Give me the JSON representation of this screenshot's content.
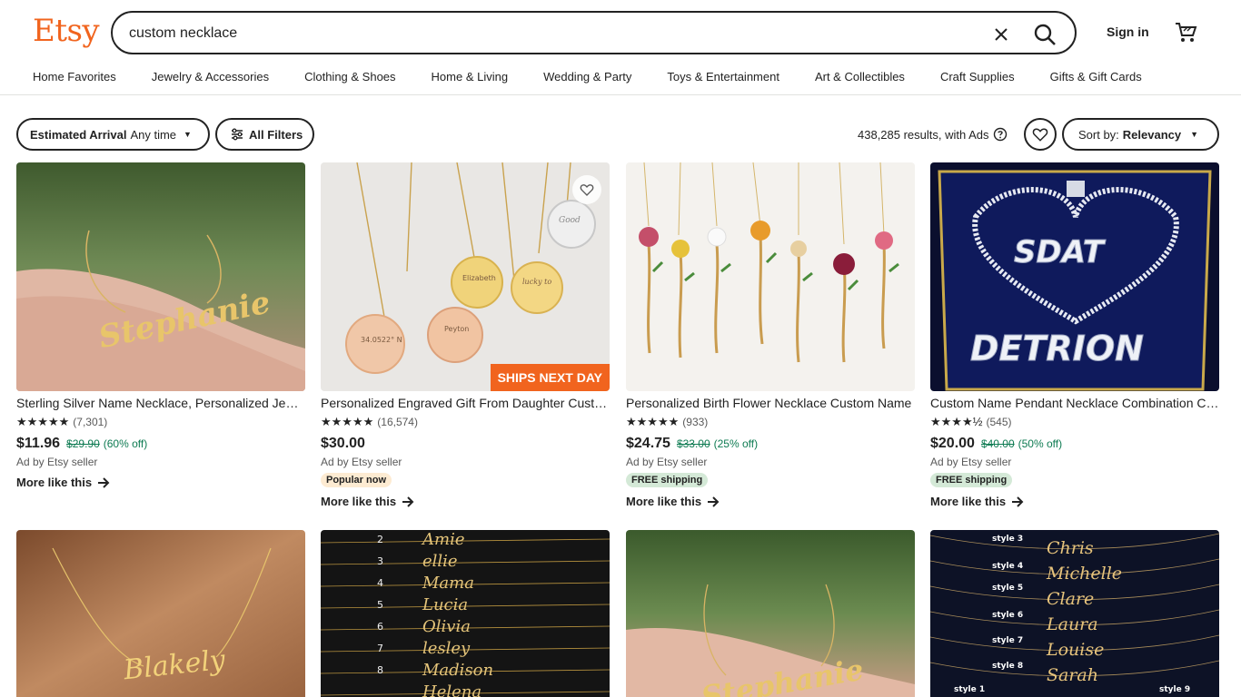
{
  "header": {
    "logo": "Etsy",
    "search_value": "custom necklace",
    "sign_in": "Sign in"
  },
  "nav": [
    "Home Favorites",
    "Jewelry & Accessories",
    "Clothing & Shoes",
    "Home & Living",
    "Wedding & Party",
    "Toys & Entertainment",
    "Art & Collectibles",
    "Craft Supplies",
    "Gifts & Gift Cards"
  ],
  "filters": {
    "arrival_label": "Estimated Arrival",
    "arrival_value": "Any time",
    "all_filters": "All Filters",
    "results_text": "438,285 results, with Ads",
    "sort_label": "Sort by:",
    "sort_value": "Relevancy"
  },
  "colors": {
    "brand": "#f1641e",
    "sale": "#0e7b52"
  },
  "listings": [
    {
      "title": "Sterling Silver Name Necklace, Personalized Jewelry",
      "stars": "★★★★★",
      "reviews": "(7,301)",
      "price": "$11.96",
      "original": "$29.90",
      "discount": "(60% off)",
      "ad": "Ad by Etsy seller",
      "badge": "",
      "more": "More like this",
      "image_text": "Stephanie"
    },
    {
      "title": "Personalized Engraved Gift From Daughter Custom Necklace",
      "stars": "★★★★★",
      "reviews": "(16,574)",
      "price": "$30.00",
      "original": "",
      "discount": "",
      "ad": "Ad by Etsy seller",
      "badge": "Popular now",
      "more": "More like this",
      "ships": "SHIPS NEXT DAY"
    },
    {
      "title": "Personalized Birth Flower Necklace Custom Name",
      "stars": "★★★★★",
      "reviews": "(933)",
      "price": "$24.75",
      "original": "$33.00",
      "discount": "(25% off)",
      "ad": "Ad by Etsy seller",
      "badge": "FREE shipping",
      "more": "More like this"
    },
    {
      "title": "Custom Name Pendant Necklace Combination Chain",
      "stars": "★★★★½",
      "reviews": "(545)",
      "price": "$20.00",
      "original": "$40.00",
      "discount": "(50% off)",
      "ad": "Ad by Etsy seller",
      "badge": "FREE shipping",
      "more": "More like this",
      "image_text_1": "SDAT",
      "image_text_2": "DETRION"
    }
  ],
  "row2": {
    "img1_text": "Blakely",
    "img2_numbers": [
      "2",
      "3",
      "4",
      "5",
      "6",
      "7",
      "8"
    ],
    "img2_names": [
      "Amie",
      "ellie",
      "Mama",
      "Lucia",
      "Olivia",
      "lesley",
      "Madison",
      "Helena"
    ],
    "img3_text": "Stephanie",
    "img4_styles": [
      "style 3",
      "style 4",
      "style 5",
      "style 6",
      "style 7",
      "style 8",
      "style 1",
      "style 9"
    ],
    "img4_names": [
      "Chris",
      "Michelle",
      "Clare",
      "Laura",
      "Louise",
      "Sarah"
    ]
  }
}
